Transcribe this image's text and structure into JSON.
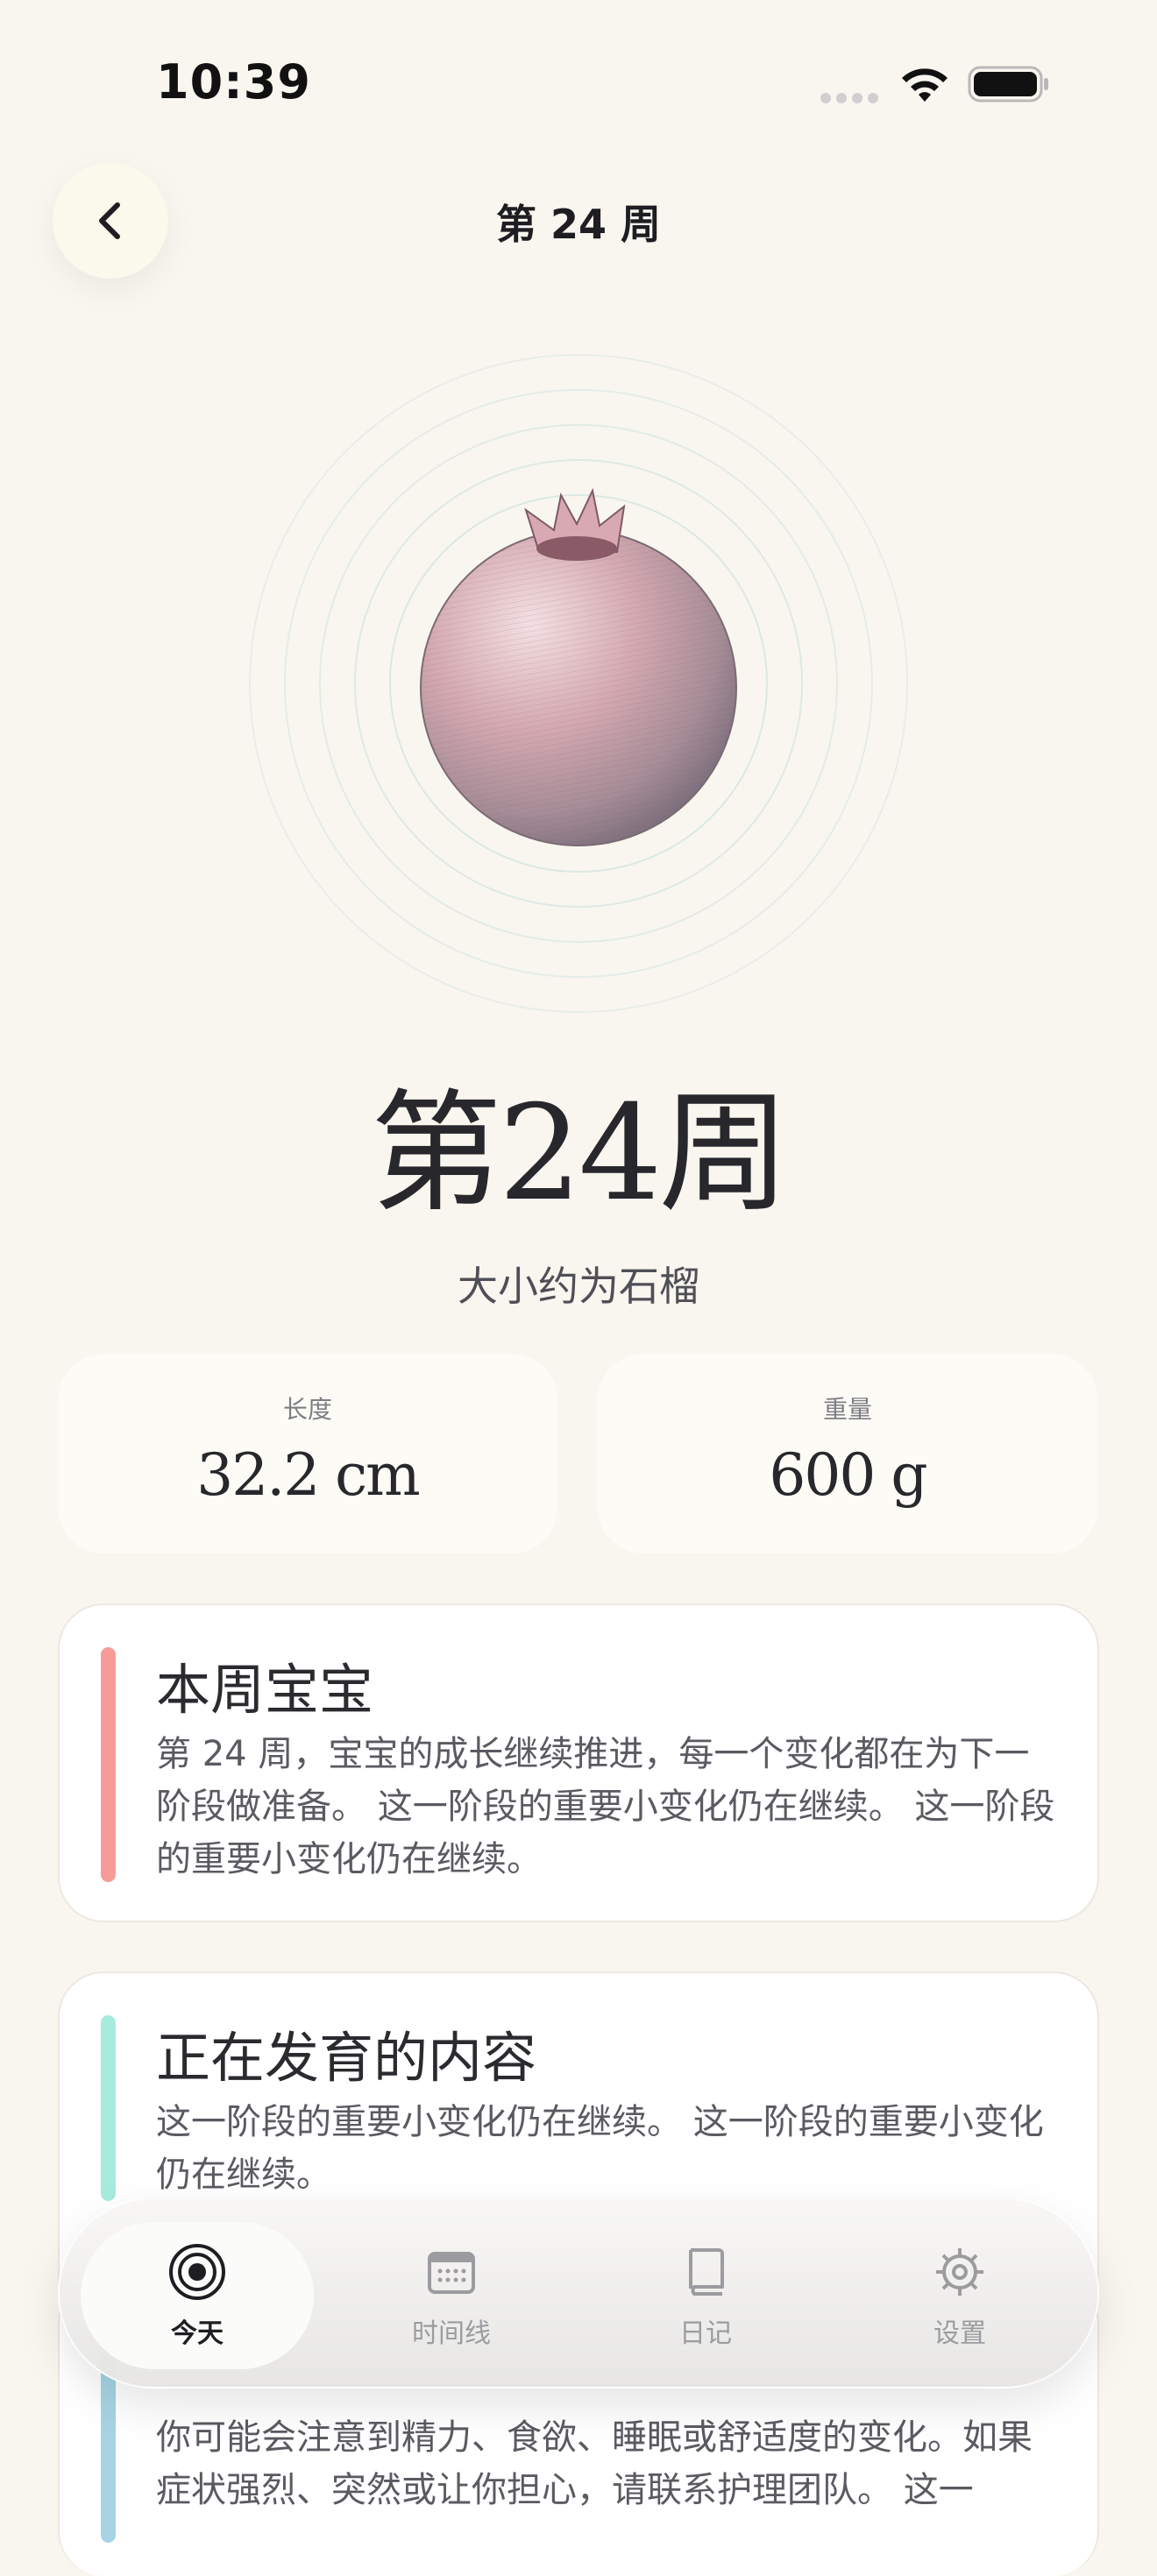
{
  "status_bar": {
    "time": "10:39"
  },
  "nav": {
    "title": "第 24 周"
  },
  "hero": {
    "fruit_icon": "pomegranate-illustration"
  },
  "week": {
    "title": "第24周",
    "subtitle": "大小约为石榴"
  },
  "stats": {
    "length": {
      "label": "长度",
      "value": "32.2 cm"
    },
    "weight": {
      "label": "重量",
      "value": "600 g"
    }
  },
  "cards": [
    {
      "title": "本周宝宝",
      "body": "第 24 周，宝宝的成长继续推进，每一个变化都在为下一阶段做准备。 这一阶段的重要小变化仍在继续。 这一阶段的重要小变化仍在继续。",
      "accent": "#f79b98"
    },
    {
      "title": "正在发育的内容",
      "body": "这一阶段的重要小变化仍在继续。 这一阶段的重要小变化仍在继续。",
      "accent": "#a8eadd"
    },
    {
      "title": "",
      "body": "你可能会注意到精力、食欲、睡眠或舒适度的变化。如果症状强烈、突然或让你担心，请联系护理团队。 这一",
      "accent": "#a6d4e4"
    }
  ],
  "tabs": [
    {
      "label": "今天",
      "icon": "today-target-icon",
      "active": true
    },
    {
      "label": "时间线",
      "icon": "calendar-icon",
      "active": false
    },
    {
      "label": "日记",
      "icon": "book-icon",
      "active": false
    },
    {
      "label": "设置",
      "icon": "gear-icon",
      "active": false
    }
  ]
}
